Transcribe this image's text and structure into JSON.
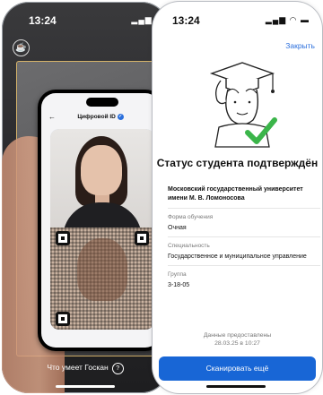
{
  "scanner_phone": {
    "time": "13:24",
    "signal": "▂▄▆ ◠",
    "hint_text": "Что умеет Госкан",
    "hint_icon": "?"
  },
  "id_screen": {
    "title": "Цифровой ID",
    "verified_icon": "✓"
  },
  "result_phone": {
    "time": "13:24",
    "signal": "▂▄▆ ◠ ▬",
    "close_label": "Закрыть",
    "status_title": "Статус студента подтверждён",
    "university": "Московский государственный университет имени М. В. Ломоносова",
    "fields": [
      {
        "label": "Форма обучения",
        "value": "Очная"
      },
      {
        "label": "Специальность",
        "value": "Государственное и муниципальное управление"
      },
      {
        "label": "Группа",
        "value": "3-18-05"
      }
    ],
    "provided_line1": "Данные предоставлены",
    "provided_line2": "28.03.25 в 10:27",
    "scan_again_label": "Сканировать ещё",
    "accent_color": "#1866d6",
    "check_color": "#3bb54a"
  }
}
